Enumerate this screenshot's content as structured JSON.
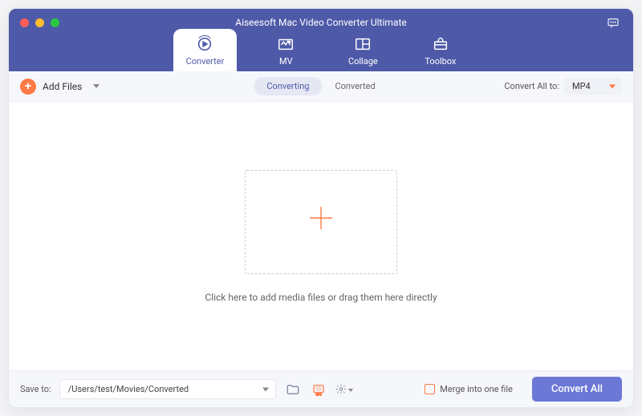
{
  "window": {
    "title": "Aiseesoft Mac Video Converter Ultimate"
  },
  "tabs": {
    "converter": "Converter",
    "mv": "MV",
    "collage": "Collage",
    "toolbox": "Toolbox"
  },
  "toolbar": {
    "add_files": "Add Files",
    "seg_converting": "Converting",
    "seg_converted": "Converted",
    "convert_all_to": "Convert All to:",
    "format_value": "MP4"
  },
  "main": {
    "drop_text": "Click here to add media files or drag them here directly"
  },
  "footer": {
    "save_to_label": "Save to:",
    "save_to_path": "/Users/test/Movies/Converted",
    "merge_label": "Merge into one file",
    "convert_all": "Convert All"
  }
}
